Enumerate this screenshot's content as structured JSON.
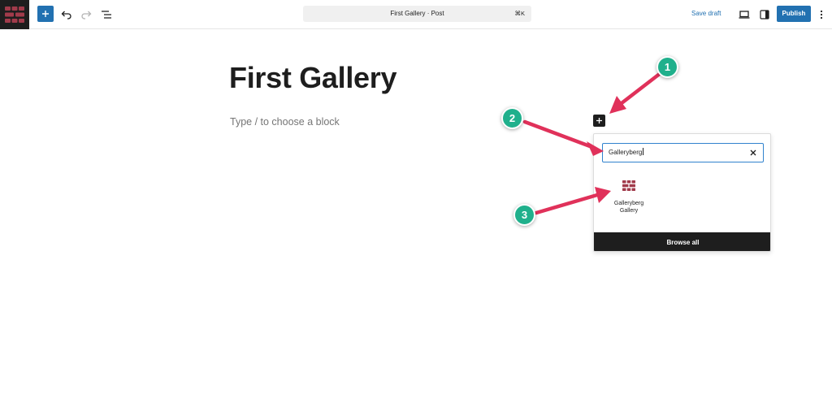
{
  "toolbar": {
    "logo_icon": "galleryberg-logo-icon",
    "inserter_icon": "plus-icon",
    "undo_icon": "undo-icon",
    "redo_icon": "redo-icon",
    "list_view_icon": "list-view-icon",
    "document_title": "First Gallery · Post",
    "shortcut": "⌘K",
    "save_draft_label": "Save draft",
    "view_icon": "desktop-preview-icon",
    "settings_icon": "sidebar-settings-icon",
    "publish_label": "Publish",
    "options_icon": "more-vertical-icon"
  },
  "editor": {
    "post_title": "First Gallery",
    "block_placeholder": "Type / to choose a block"
  },
  "inserter": {
    "search_value": "Galleryberg",
    "clear_icon": "close-icon",
    "results": [
      {
        "label": "Galleryberg Gallery",
        "icon": "galleryberg-block-icon"
      }
    ],
    "browse_all_label": "Browse all"
  },
  "annotations": {
    "steps": [
      "1",
      "2",
      "3"
    ]
  },
  "colors": {
    "accent": "#2271b1",
    "brand_icon": "#a13b4b",
    "annotation_arrow": "#e0315a",
    "annotation_badge": "#20b08c"
  }
}
